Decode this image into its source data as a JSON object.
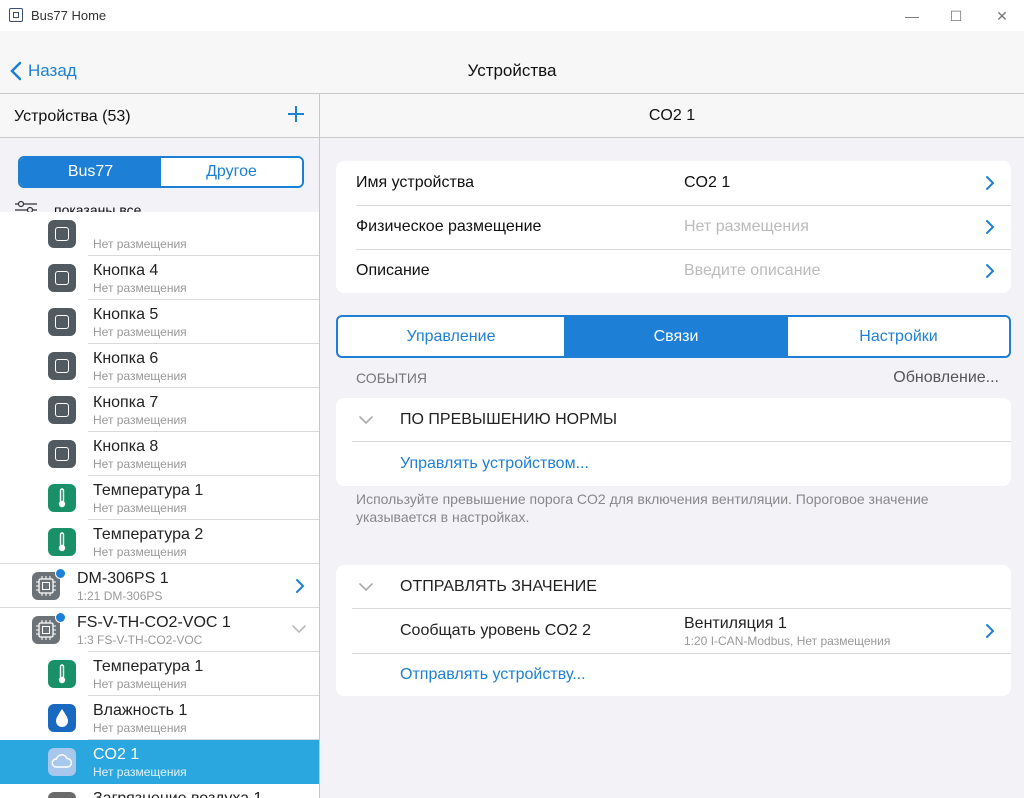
{
  "window": {
    "title": "Bus77 Home",
    "minimize": "—",
    "maximize": "☐",
    "close": "✕"
  },
  "nav": {
    "back_label": "Назад",
    "title": "Устройства"
  },
  "sidebar": {
    "title": "Устройства (53)",
    "segments": [
      "Bus77",
      "Другое"
    ],
    "filter_label": "показаны все",
    "rows": [
      {
        "name": "",
        "sub": "Нет размещения",
        "icon": "power"
      },
      {
        "name": "Кнопка 4",
        "sub": "Нет размещения",
        "icon": "power"
      },
      {
        "name": "Кнопка 5",
        "sub": "Нет размещения",
        "icon": "power"
      },
      {
        "name": "Кнопка 6",
        "sub": "Нет размещения",
        "icon": "power"
      },
      {
        "name": "Кнопка 7",
        "sub": "Нет размещения",
        "icon": "power"
      },
      {
        "name": "Кнопка 8",
        "sub": "Нет размещения",
        "icon": "power"
      },
      {
        "name": "Температура 1",
        "sub": "Нет размещения",
        "icon": "thermometer"
      },
      {
        "name": "Температура 2",
        "sub": "Нет размещения",
        "icon": "thermometer"
      },
      {
        "name": "DM-306PS 1",
        "sub": "1:21 DM-306PS",
        "icon": "chip"
      },
      {
        "name": "FS-V-TH-CO2-VOC 1",
        "sub": "1:3 FS-V-TH-CO2-VOC",
        "icon": "chip"
      },
      {
        "name": "Температура 1",
        "sub": "Нет размещения",
        "icon": "thermometer"
      },
      {
        "name": "Влажность 1",
        "sub": "Нет размещения",
        "icon": "droplet"
      },
      {
        "name": "CO2 1",
        "sub": "Нет размещения",
        "icon": "cloud"
      },
      {
        "name": "Загрязнение воздуха 1",
        "sub": "",
        "icon": "air"
      }
    ]
  },
  "main": {
    "header": "CO2 1",
    "props": [
      {
        "label": "Имя устройства",
        "value": "CO2 1"
      },
      {
        "label": "Физическое размещение",
        "value": "Нет размещения"
      },
      {
        "label": "Описание",
        "value": "Введите описание"
      }
    ],
    "tabs": [
      "Управление",
      "Связи",
      "Настройки"
    ],
    "events_label": "СОБЫТИЯ",
    "events_status": "Обновление...",
    "group1": {
      "title": "ПО ПРЕВЫШЕНИЮ НОРМЫ",
      "link": "Управлять устройством...",
      "hint": "Используйте превышение порога CO2 для включения вентиляции. Пороговое значение указывается в настройках."
    },
    "group2": {
      "title": "ОТПРАВЛЯТЬ ЗНАЧЕНИЕ",
      "item_label": "Сообщать уровень CO2 2",
      "target_name": "Вентиляция 1",
      "target_sub": "1:20 I-CAN-Modbus, Нет размещения",
      "link": "Отправлять устройству..."
    }
  }
}
